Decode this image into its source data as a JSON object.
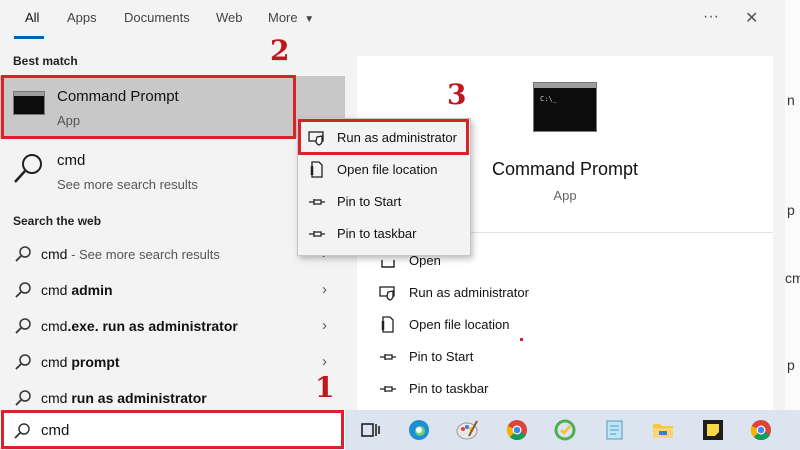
{
  "tabs": [
    {
      "label": "All",
      "active": true
    },
    {
      "label": "Apps"
    },
    {
      "label": "Documents"
    },
    {
      "label": "Web"
    },
    {
      "label": "More"
    }
  ],
  "header": {
    "more_icon": "ellipsis-icon",
    "close_icon": "close-icon",
    "ellipsis": "···",
    "close": "✕",
    "more_caret": "▼"
  },
  "best_match": {
    "section_title": "Best match",
    "name": "Command Prompt",
    "type": "App"
  },
  "search_result": {
    "name": "cmd",
    "subtitle": "See more search results"
  },
  "web": {
    "section_title": "Search the web",
    "items": [
      {
        "prefix": "cmd",
        "bold": "",
        "suffix": " - See more search results"
      },
      {
        "prefix": "cmd ",
        "bold": "admin",
        "suffix": ""
      },
      {
        "prefix": "cmd",
        "bold": ".exe. run as administrator",
        "suffix": ""
      },
      {
        "prefix": "cmd ",
        "bold": "prompt",
        "suffix": ""
      },
      {
        "prefix": "cmd ",
        "bold": "run as administrator",
        "suffix": ""
      }
    ],
    "chevron": "›"
  },
  "context_menu": {
    "items": [
      {
        "label": "Run as administrator",
        "icon": "shield-icon"
      },
      {
        "label": "Open file location",
        "icon": "file-location-icon"
      },
      {
        "label": "Pin to Start",
        "icon": "pin-icon"
      },
      {
        "label": "Pin to taskbar",
        "icon": "pin-icon"
      }
    ]
  },
  "detail": {
    "name": "Command Prompt",
    "type": "App",
    "actions": [
      {
        "label": "Open",
        "icon": "open-icon"
      },
      {
        "label": "Run as administrator",
        "icon": "shield-icon"
      },
      {
        "label": "Open file location",
        "icon": "file-location-icon"
      },
      {
        "label": "Pin to Start",
        "icon": "pin-icon"
      },
      {
        "label": "Pin to taskbar",
        "icon": "pin-icon"
      }
    ]
  },
  "search_box": {
    "value": "cmd"
  },
  "annotations": [
    "1",
    "2",
    "3"
  ],
  "right_strip": [
    "n",
    "p",
    "cm",
    "p"
  ],
  "taskbar_icons": [
    "task-view-icon",
    "edge-icon",
    "paint-icon",
    "chrome-icon",
    "green-app-icon",
    "notepad-icon",
    "file-explorer-icon",
    "sticky-notes-icon",
    "chrome-icon"
  ],
  "colors": {
    "accent": "#0063b1",
    "highlight": "#d9232b",
    "selected": "#c8c8c8"
  }
}
